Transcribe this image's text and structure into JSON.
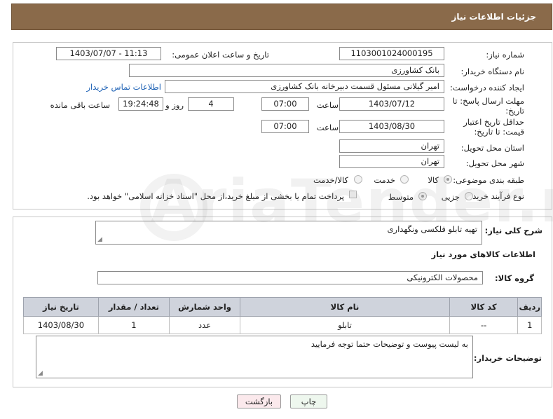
{
  "header": {
    "title": "جزئیات اطلاعات نیاز"
  },
  "form": {
    "need_number_label": "شماره نیاز:",
    "need_number": "1103001024000195",
    "announce_label": "تاریخ و ساعت اعلان عمومی:",
    "announce_value": "1403/07/07 - 11:13",
    "buyer_org_label": "نام دستگاه خریدار:",
    "buyer_org": "بانک کشاورزی",
    "creator_label": "ایجاد کننده درخواست:",
    "creator": "امیر گیلانی مسئول قسمت دبیرخانه بانک کشاورزی",
    "contact_link": "اطلاعات تماس خریدار",
    "deadline_label": "مهلت ارسال پاسخ: تا تاریخ:",
    "deadline_date": "1403/07/12",
    "time_label": "ساعت",
    "deadline_time": "07:00",
    "days_value": "4",
    "days_label": "روز و",
    "remaining_time": "19:24:48",
    "remaining_label": "ساعت باقی مانده",
    "validity_label": "حداقل تاریخ اعتبار قیمت: تا تاریخ:",
    "validity_date": "1403/08/30",
    "validity_time": "07:00",
    "province_label": "استان محل تحویل:",
    "province": "تهران",
    "city_label": "شهر محل تحویل:",
    "city": "تهران",
    "category_label": "طبقه بندی موضوعی:",
    "category_options": [
      "کالا",
      "خدمت",
      "کالا/خدمت"
    ],
    "process_label": "نوع فرآیند خرید :",
    "process_options": [
      "جزیی",
      "متوسط"
    ],
    "payment_note": "پرداخت تمام یا بخشی از مبلغ خرید،از محل \"اسناد خزانه اسلامی\" خواهد بود."
  },
  "detail": {
    "summary_label": "شرح کلی نیاز:",
    "summary": "تهیه تابلو فلکسی ونگهداری",
    "goods_info_title": "اطلاعات کالاهای مورد نیاز",
    "group_label": "گروه کالا:",
    "group": "محصولات الکترونیکی",
    "table": {
      "headers": [
        "ردیف",
        "کد کالا",
        "نام کالا",
        "واحد شمارش",
        "تعداد / مقدار",
        "تاریخ نیاز"
      ],
      "rows": [
        [
          "1",
          "--",
          "تابلو",
          "عدد",
          "1",
          "1403/08/30"
        ]
      ]
    },
    "buyer_notes_label": "توضیحات خریدار:",
    "buyer_notes": "به لیست پیوست و توضیحات حتما توجه فرمایید"
  },
  "buttons": {
    "print": "چاپ",
    "back": "بازگشت"
  },
  "watermark": "AriaTender.net",
  "colors": {
    "header_bg": "#8a6a4a",
    "table_header_bg": "#cfd3dc",
    "link": "#1a5fb4"
  }
}
